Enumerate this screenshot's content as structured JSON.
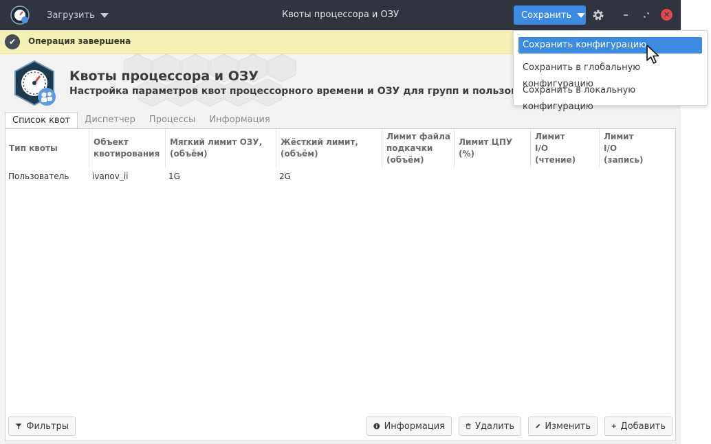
{
  "titlebar": {
    "load_label": "Загрузить",
    "title": "Квоты процессора и ОЗУ",
    "save_label": "Сохранить",
    "accent": "#3d8be0"
  },
  "notification": {
    "text": "Операция завершена"
  },
  "header": {
    "title": "Квоты процессора и ОЗУ",
    "subtitle": "Настройка параметров квот процессорного времени и ОЗУ для групп и пользователей"
  },
  "tabs": [
    {
      "label": "Список квот",
      "active": true
    },
    {
      "label": "Диспетчер",
      "active": false
    },
    {
      "label": "Процессы",
      "active": false
    },
    {
      "label": "Информация",
      "active": false
    }
  ],
  "table": {
    "columns": [
      [
        "Тип квоты"
      ],
      [
        "Объект",
        "квотирования"
      ],
      [
        "Мягкий лимит ОЗУ,",
        "(объём)"
      ],
      [
        "Жёсткий лимит,",
        "(объём)"
      ],
      [
        "Лимит файла",
        "подкачки",
        "(объём)"
      ],
      [
        "Лимит ЦПУ",
        "(%)"
      ],
      [
        "Лимит",
        "I/O",
        "(чтение)"
      ],
      [
        "Лимит",
        "I/O",
        "(запись)"
      ]
    ],
    "rows": [
      [
        "Пользователь",
        "ivanov_ii",
        "1G",
        "2G",
        "",
        "",
        "",
        ""
      ]
    ]
  },
  "buttons": {
    "filters": "Фильтры",
    "info": "Информация",
    "delete": "Удалить",
    "edit": "Изменить",
    "add": "Добавить"
  },
  "save_menu": {
    "items": [
      "Сохранить конфигурацию",
      "Сохранить в глобальную конфигурацию",
      "Сохранить в локальную конфигурацию"
    ],
    "selected_index": 0
  }
}
